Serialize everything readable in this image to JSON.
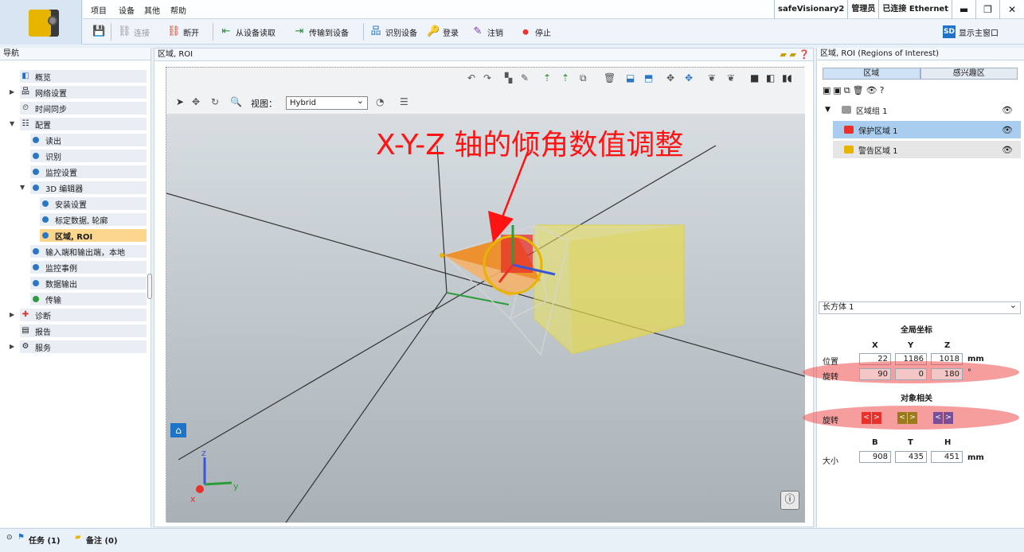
{
  "menu": [
    "项目",
    "设备",
    "其他",
    "帮助"
  ],
  "status": {
    "device": "safeVisionary2",
    "role": "管理员",
    "connection": "已连接 Ethernet"
  },
  "window_controls": [
    "▬",
    "❐",
    "✕"
  ],
  "toolbar": {
    "connect": "连接",
    "disconnect": "断开",
    "read": "从设备读取",
    "transfer": "传输到设备",
    "identify": "识别设备",
    "login": "登录",
    "logout": "注销",
    "stop": "停止",
    "main_window": "显示主窗口"
  },
  "nav": {
    "title": "导航",
    "items": [
      "概览",
      "网络设置",
      "时间同步",
      "配置",
      "读出",
      "识别",
      "监控设置",
      "3D 编辑器",
      "安装设置",
      "标定数据, 轮廓",
      "区域, ROI",
      "输入端和输出端，本地",
      "监控事例",
      "数据输出",
      "传输",
      "诊断",
      "报告",
      "服务"
    ]
  },
  "center": {
    "title": "区域, ROI",
    "view_label": "视图：",
    "view_value": "Hybrid",
    "annotation": "X-Y-Z 轴的倾角数值调整",
    "axes": {
      "x": "x",
      "y": "y",
      "z": "z"
    }
  },
  "right": {
    "title": "区域, ROI (Regions of Interest)",
    "tabs": [
      "区域",
      "感兴趣区"
    ],
    "tree": {
      "group": "区域组 1",
      "protect": "保护区域 1",
      "warning": "警告区域 1"
    },
    "shape_select": "长方体 1",
    "global_title": "全局坐标",
    "cols": [
      "X",
      "Y",
      "Z"
    ],
    "position_label": "位置",
    "position": [
      "22",
      "1186",
      "1018"
    ],
    "position_unit": "mm",
    "rotation_label": "旋转",
    "rotation": [
      "90",
      "0",
      "180"
    ],
    "rotation_unit": "°",
    "object_title": "对象相关",
    "obj_rotation_label": "旋转",
    "size_cols": [
      "B",
      "T",
      "H"
    ],
    "size_label": "大小",
    "size": [
      "908",
      "435",
      "451"
    ],
    "size_unit": "mm"
  },
  "bottom": {
    "tasks": "任务 (1)",
    "notes": "备注 (0)"
  },
  "colors": {
    "selected": "#fbd68c",
    "accent": "#1f74c7",
    "protect": "#e8312a",
    "warning": "#e7b400",
    "annotation": "#ff1414"
  }
}
